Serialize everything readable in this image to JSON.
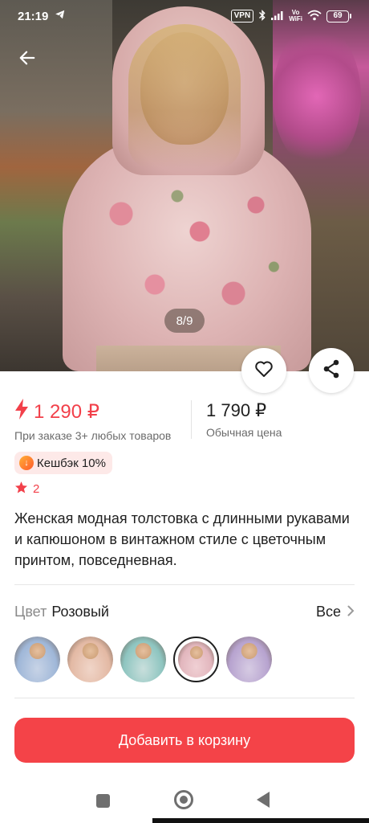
{
  "status_bar": {
    "time": "21:19",
    "vpn": "VPN",
    "vowifi_top": "Vo",
    "vowifi_bottom": "WiFi",
    "battery": "69"
  },
  "hero": {
    "image_counter": "8/9"
  },
  "price": {
    "promo_price": "1 290 ₽",
    "promo_note": "При заказе 3+ любых товаров",
    "regular_price": "1 790 ₽",
    "regular_note": "Обычная цена"
  },
  "cashback": {
    "label": "Кешбэк 10%"
  },
  "rating": {
    "value": "2"
  },
  "product": {
    "title": "Женская модная толстовка с длинными рукавами и капюшоном в винтажном стиле с цветочным принтом, повседневная."
  },
  "color": {
    "label": "Цвет",
    "selected": "Розовый",
    "all_link": "Все",
    "swatches": [
      {
        "color_a": "#9fb7d8",
        "color_b": "#c7d3e6"
      },
      {
        "color_a": "#e3b9a4",
        "color_b": "#f0d5c8"
      },
      {
        "color_a": "#8ec5c0",
        "color_b": "#c9dfdc"
      },
      {
        "color_a": "#e2b6bd",
        "color_b": "#f0d0d4"
      },
      {
        "color_a": "#b7a3cf",
        "color_b": "#d6cbe3"
      }
    ],
    "selected_index": 3
  },
  "actions": {
    "add_to_cart": "Добавить в корзину"
  },
  "colors": {
    "accent": "#f44348",
    "price_red": "#f2404a",
    "cashback_bg": "#fde9e8"
  }
}
